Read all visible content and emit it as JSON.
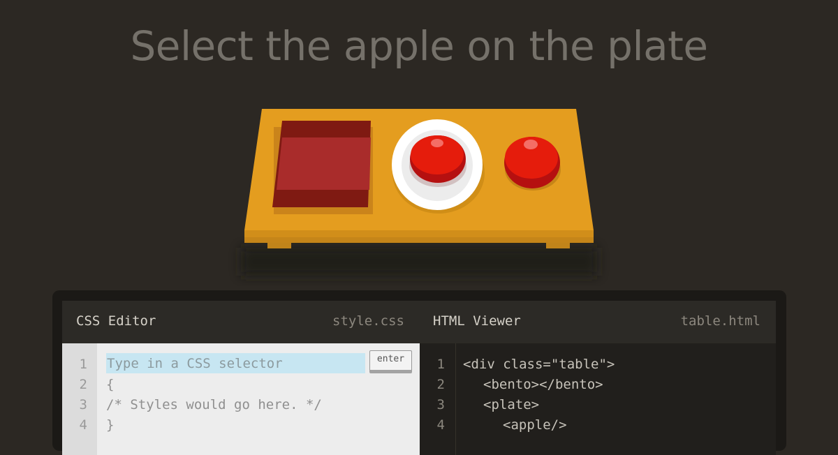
{
  "level": {
    "instruction": "Select the apple on the plate"
  },
  "table": {
    "items": [
      {
        "type": "bento",
        "icon": "bento-icon"
      },
      {
        "type": "plate",
        "icon": "plate-icon",
        "contains": "apple"
      },
      {
        "type": "apple",
        "icon": "apple-icon"
      }
    ],
    "colors": {
      "table_top": "#e39c1e",
      "table_front": "#d6901a",
      "bento": "#8e1f1c",
      "apple": "#d91d14",
      "plate": "#ffffff"
    }
  },
  "css_editor": {
    "title": "CSS Editor",
    "file": "style.css",
    "input_placeholder": "Type in a CSS selector",
    "enter_label": "enter",
    "line_numbers": [
      "1",
      "2",
      "3",
      "4"
    ],
    "lines": [
      "{",
      "/* Styles would go here. */",
      "}"
    ]
  },
  "html_viewer": {
    "title": "HTML Viewer",
    "file": "table.html",
    "line_numbers": [
      "1",
      "2",
      "3",
      "4"
    ],
    "lines": [
      "<div class=\"table\">",
      "<bento></bento>",
      "<plate>",
      "<apple/>"
    ]
  }
}
